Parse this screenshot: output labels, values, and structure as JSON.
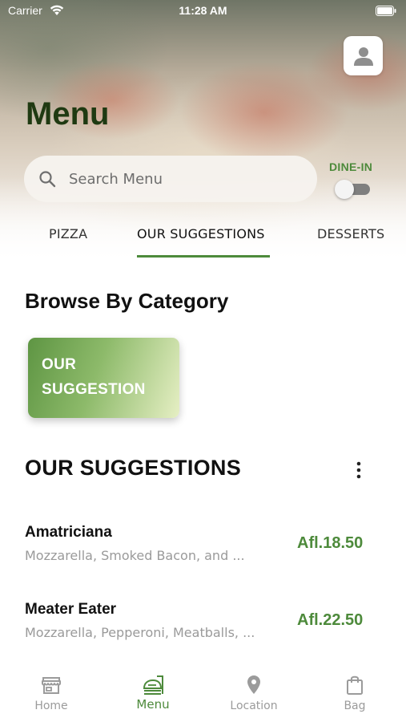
{
  "status_bar": {
    "carrier": "Carrier",
    "time": "11:28 AM"
  },
  "header": {
    "title": "Menu",
    "search": {
      "placeholder": "Search Menu",
      "value": ""
    },
    "dine_in": {
      "label": "DINE-IN",
      "enabled": false
    }
  },
  "tabs": [
    {
      "label": "PIZZA",
      "active": false
    },
    {
      "label": "OUR SUGGESTIONS",
      "active": true
    },
    {
      "label": "DESSERTS",
      "active": false
    }
  ],
  "browse": {
    "title": "Browse By Category",
    "categories": [
      {
        "label": "OUR SUGGESTION"
      }
    ]
  },
  "suggestions": {
    "title": "OUR SUGGESTIONS",
    "items": [
      {
        "name": "Amatriciana",
        "description": "Mozzarella, Smoked Bacon, and ...",
        "price": "Afl.18.50"
      },
      {
        "name": "Meater Eater",
        "description": "Mozzarella, Pepperoni, Meatballs, ...",
        "price": "Afl.22.50"
      }
    ]
  },
  "bottom_nav": [
    {
      "label": "Home",
      "icon": "store-icon",
      "active": false
    },
    {
      "label": "Menu",
      "icon": "menu-icon",
      "active": true
    },
    {
      "label": "Location",
      "icon": "location-pin-icon",
      "active": false
    },
    {
      "label": "Bag",
      "icon": "bag-icon",
      "active": false
    }
  ],
  "colors": {
    "accent": "#4d8a3b",
    "title": "#1f3a12",
    "muted": "#9b9b9b"
  }
}
